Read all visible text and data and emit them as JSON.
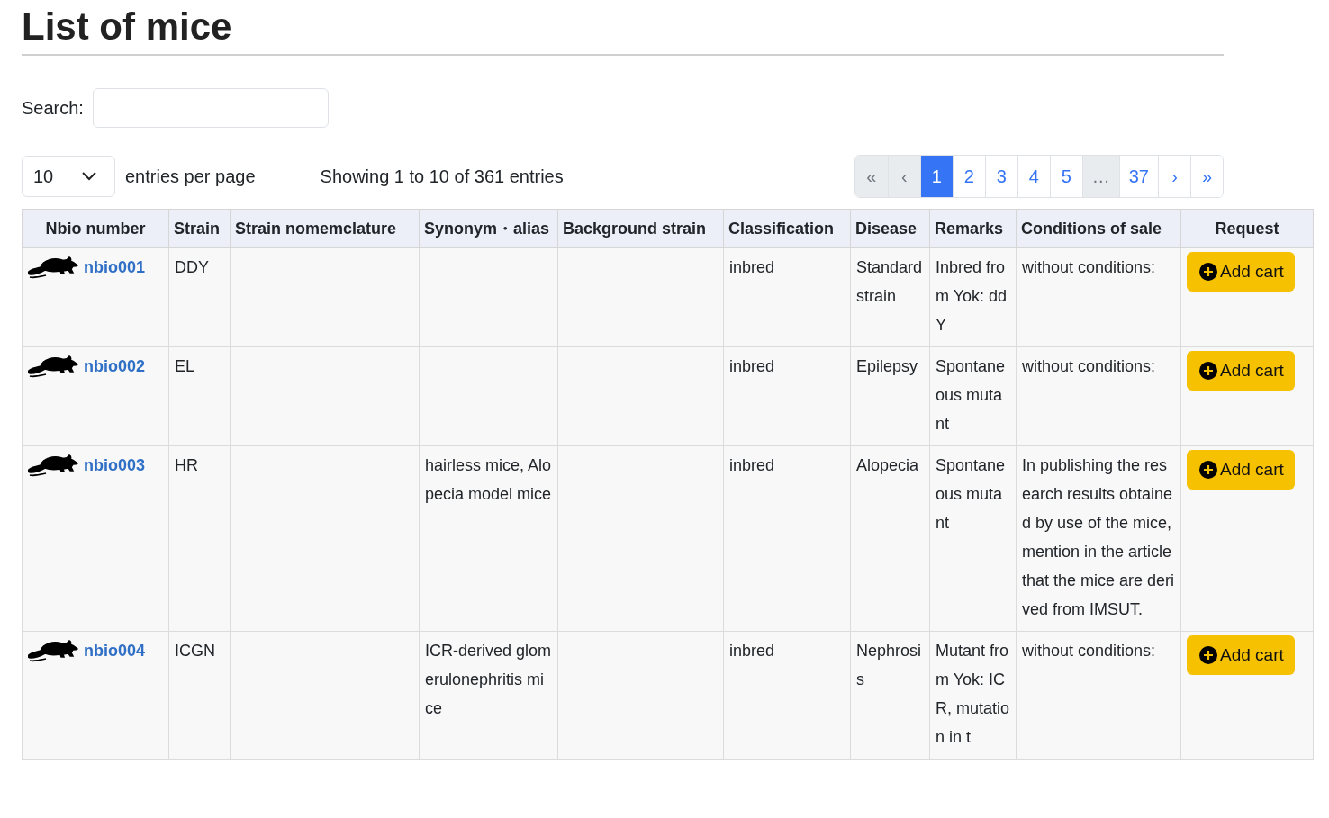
{
  "title": "List of mice",
  "search": {
    "label": "Search:"
  },
  "page_size": {
    "value": "10",
    "label": "entries per page"
  },
  "info": "Showing 1 to 10 of 361 entries",
  "pagination": [
    {
      "label": "«",
      "selected": false,
      "disabled": true
    },
    {
      "label": "‹",
      "selected": false,
      "disabled": true
    },
    {
      "label": "1",
      "selected": true,
      "disabled": false
    },
    {
      "label": "2",
      "selected": false,
      "disabled": false
    },
    {
      "label": "3",
      "selected": false,
      "disabled": false
    },
    {
      "label": "4",
      "selected": false,
      "disabled": false
    },
    {
      "label": "5",
      "selected": false,
      "disabled": false
    },
    {
      "label": "…",
      "selected": false,
      "disabled": true
    },
    {
      "label": "37",
      "selected": false,
      "disabled": false
    },
    {
      "label": "›",
      "selected": false,
      "disabled": false
    },
    {
      "label": "»",
      "selected": false,
      "disabled": false
    }
  ],
  "table": {
    "columns": [
      "Nbio number",
      "Strain",
      "Strain nomemclature",
      "Synonym・alias",
      "Background strain",
      "Classification",
      "Disease",
      "Remarks",
      "Conditions of sale",
      "Request"
    ],
    "rows": [
      {
        "nbio_number": "nbio001",
        "strain": "DDY",
        "classification": "inbred",
        "disease": "Standard strain",
        "remarks": "Inbred from Yok: ddY",
        "conditions_of_sale": "without conditions:",
        "request": "Add cart"
      },
      {
        "nbio_number": "nbio002",
        "strain": "EL",
        "classification": "inbred",
        "disease": "Epilepsy",
        "remarks": "Spontaneous mutant",
        "conditions_of_sale": "without conditions:",
        "request": "Add cart"
      },
      {
        "nbio_number": "nbio003",
        "strain": "HR",
        "synonym_alias": "hairless mice, Alopecia model mice",
        "classification": "inbred",
        "disease": "Alopecia",
        "remarks": "Spontaneous mutant",
        "conditions_of_sale": "In publishing the research results obtained by use of the mice, mention in the article that the mice are derived from IMSUT.",
        "request": "Add cart"
      },
      {
        "nbio_number": "nbio004",
        "strain": "ICGN",
        "synonym_alias": "ICR-derived glomerulonephritis mice",
        "classification": "inbred",
        "disease": "Nephrosis",
        "remarks": "Mutant from Yok: ICR, mutation in t",
        "conditions_of_sale": "without conditions:",
        "request": "Add cart"
      }
    ]
  }
}
